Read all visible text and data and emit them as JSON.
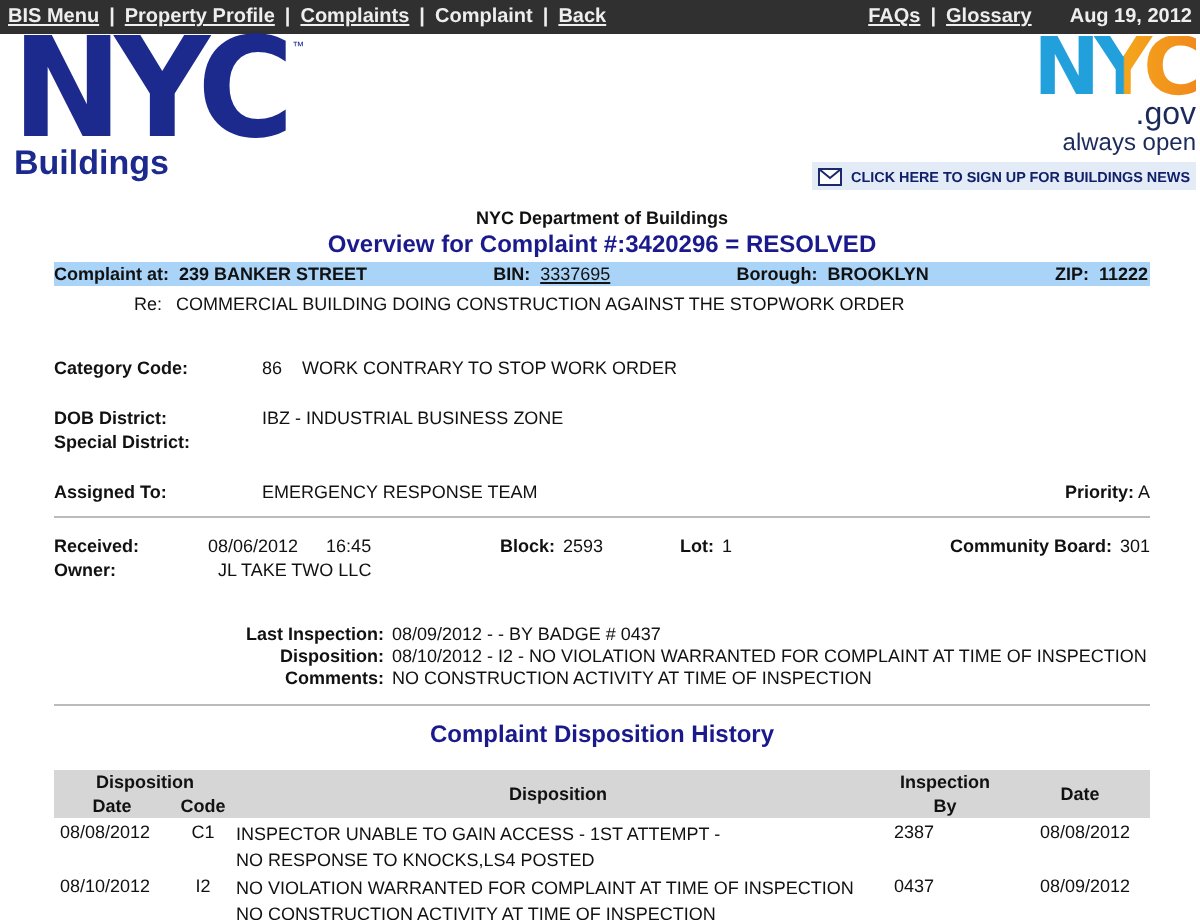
{
  "nav": {
    "separator": "|",
    "links": [
      {
        "label": "BIS Menu",
        "link": true
      },
      {
        "label": "Property Profile",
        "link": true
      },
      {
        "label": "Complaints",
        "link": true
      },
      {
        "label": "Complaint",
        "link": false
      },
      {
        "label": "Back",
        "link": true
      }
    ],
    "right_links": [
      {
        "label": "FAQs",
        "link": true
      },
      {
        "label": "Glossary",
        "link": true
      }
    ],
    "date": "Aug 19, 2012"
  },
  "header": {
    "logo": "NYC",
    "trademark": "™",
    "brand": "Buildings",
    "gov_logo": "NYC",
    "gov_suffix": ".gov",
    "tagline": "always open",
    "signup": "CLICK HERE TO SIGN UP FOR BUILDINGS NEWS"
  },
  "agency": "NYC Department of Buildings",
  "title": "Overview for Complaint #:3420296 = RESOLVED",
  "address_bar": [
    {
      "label": "Complaint at:",
      "value": "239 BANKER STREET",
      "link": false
    },
    {
      "label": "BIN:",
      "value": "3337695",
      "link": true
    },
    {
      "label": "Borough:",
      "value": "BROOKLYN",
      "link": false
    },
    {
      "label": "ZIP:",
      "value": "11222",
      "link": false
    }
  ],
  "re": {
    "label": "Re:",
    "value": "COMMERCIAL BUILDING DOING CONSTRUCTION AGAINST THE STOPWORK ORDER"
  },
  "category": {
    "label": "Category Code:",
    "code": "86",
    "value": "WORK CONTRARY TO STOP WORK ORDER"
  },
  "dob_district": {
    "label": "DOB District:",
    "value": "IBZ - INDUSTRIAL BUSINESS ZONE"
  },
  "special_district": {
    "label": "Special District:"
  },
  "assigned": {
    "label": "Assigned To:",
    "value": "EMERGENCY RESPONSE TEAM"
  },
  "priority": {
    "label": "Priority:",
    "value": "A"
  },
  "received": {
    "label": "Received:",
    "date": "08/06/2012",
    "time": "16:45"
  },
  "block": {
    "label": "Block:",
    "value": "2593"
  },
  "lot": {
    "label": "Lot:",
    "value": "1"
  },
  "community_board": {
    "label": "Community Board:",
    "value": "301"
  },
  "owner": {
    "label": "Owner:",
    "value": "JL TAKE TWO LLC"
  },
  "inspection": [
    {
      "label": "Last Inspection:",
      "value": "08/09/2012 - - BY BADGE # 0437"
    },
    {
      "label": "Disposition:",
      "value": "08/10/2012 - I2 - NO VIOLATION WARRANTED FOR COMPLAINT AT TIME OF INSPECTION"
    },
    {
      "label": "Comments:",
      "value": "NO CONSTRUCTION ACTIVITY AT TIME OF INSPECTION"
    }
  ],
  "history": {
    "title": "Complaint Disposition History",
    "header": {
      "group": "Disposition",
      "date": "Date",
      "code": "Code",
      "disposition": "Disposition",
      "inspection_by": [
        "Inspection",
        "By"
      ],
      "inspection_date": "Date"
    },
    "rows": [
      {
        "date": "08/08/2012",
        "code": "C1",
        "disposition": [
          "INSPECTOR UNABLE TO GAIN ACCESS - 1ST ATTEMPT -",
          "NO RESPONSE TO KNOCKS,LS4 POSTED"
        ],
        "inspection_by": "2387",
        "inspection_date": "08/08/2012"
      },
      {
        "date": "08/10/2012",
        "code": "I2",
        "disposition": [
          "NO VIOLATION WARRANTED FOR COMPLAINT AT TIME OF INSPECTION",
          "NO CONSTRUCTION ACTIVITY AT TIME OF INSPECTION"
        ],
        "inspection_by": "0437",
        "inspection_date": "08/09/2012"
      }
    ]
  }
}
